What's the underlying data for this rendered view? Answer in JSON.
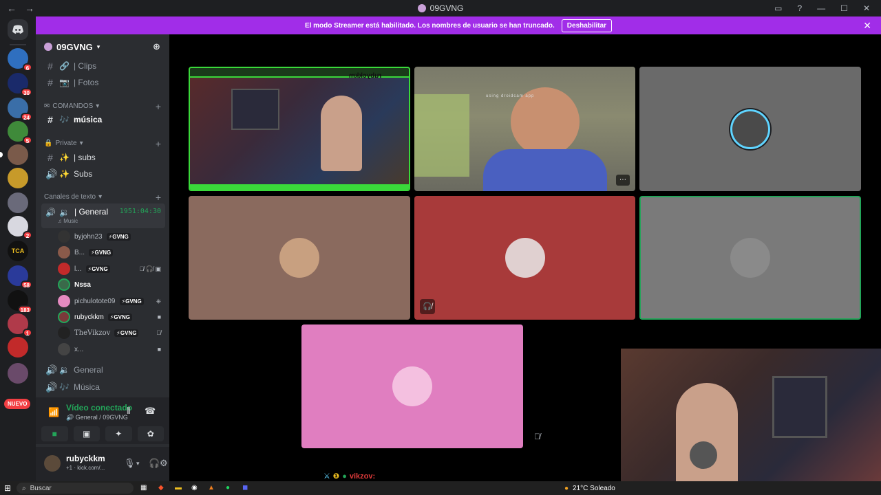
{
  "window": {
    "title": "09GVNG",
    "back_icon": "←",
    "forward_icon": "→"
  },
  "banner": {
    "text": "El modo Streamer está habilitado. Los nombres de usuario se han truncado.",
    "button": "Deshabilitar"
  },
  "server_badges": [
    "6",
    "30",
    "24",
    "5",
    "58",
    "183",
    "1",
    "2"
  ],
  "server_new": "NUEVO",
  "guild": {
    "name": "09GVNG"
  },
  "channels": {
    "clips": "| Clips",
    "fotos": "| Fotos",
    "cat_comandos": "COMANDOS",
    "musica": "música",
    "cat_private": "Private",
    "subs1": "| subs",
    "subs2": "Subs",
    "cat_texto": "Canales de texto",
    "voice_general": "| General",
    "voice_time": "1951:04:30",
    "voice_activity": "Music",
    "general1": "General",
    "musica2": "Música"
  },
  "voice_users": [
    {
      "name": "byjohn23",
      "tag": "GVNG"
    },
    {
      "name": "B...",
      "tag": "GVNG"
    },
    {
      "name": "l...",
      "tag": "GVNG"
    },
    {
      "name": "Nssa",
      "tag": ""
    },
    {
      "name": "pichulotote09",
      "tag": "GVNG"
    },
    {
      "name": "rubyckkm",
      "tag": "GVNG"
    },
    {
      "name": "TheVikzov",
      "tag": "GVNG"
    },
    {
      "name": "x...",
      "tag": ""
    }
  ],
  "rtc": {
    "status": "Vídeo conectado",
    "location": "General / 09GVNG"
  },
  "user": {
    "name": "rubyckkm",
    "status": "+1 · kick.com/..."
  },
  "tiles": {
    "t1_text": "rubyckkm",
    "t2_text": "using droidcam app"
  },
  "overlay_text": "vikzov:",
  "taskbar": {
    "search": "Buscar",
    "weather": "21°C Soleado"
  },
  "colors": {
    "banner": "#a12de8",
    "accent": "#23a559",
    "badge": "#f23f43"
  }
}
